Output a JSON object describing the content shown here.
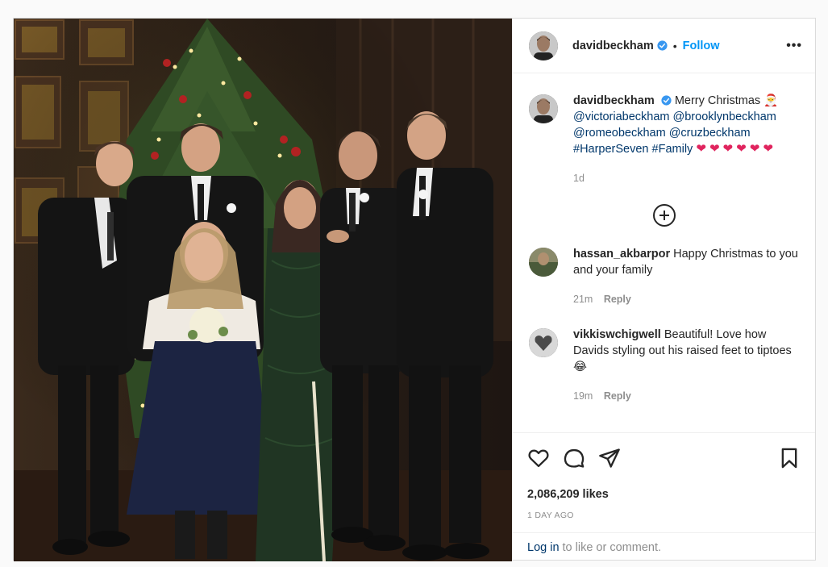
{
  "post": {
    "photo_alt": "",
    "header": {
      "username": "davidbeckham",
      "separator": "•",
      "follow_label": "Follow",
      "more_label": "•••"
    },
    "caption": {
      "username": "davidbeckham",
      "text": "Merry Christmas",
      "emoji": "🎅",
      "mentions": [
        "@victoriabeckham",
        "@brooklynbeckham",
        "@romeobeckham",
        "@cruzbeckham"
      ],
      "hashtags": [
        "#HarperSeven",
        "#Family"
      ],
      "hearts": [
        "❤",
        "❤",
        "❤",
        "❤",
        "❤",
        "❤"
      ],
      "time": "1d"
    },
    "comments": [
      {
        "username": "hassan_akbarpor",
        "text": "Happy Christmas to you and your family",
        "time": "21m",
        "reply_label": "Reply"
      },
      {
        "username": "vikkiswchigwell",
        "text": "Beautiful! Love how Davids styling out his raised feet to tiptoes",
        "emoji": "😂",
        "time": "19m",
        "reply_label": "Reply"
      }
    ],
    "likes": "2,086,209 likes",
    "posted_ago": "1 DAY AGO",
    "login": {
      "link_label": "Log in",
      "rest": "to like or comment."
    }
  },
  "colors": {
    "accent": "#0095f6",
    "link": "#00376b",
    "muted": "#8e8e8e",
    "heart": "#e0245e"
  }
}
